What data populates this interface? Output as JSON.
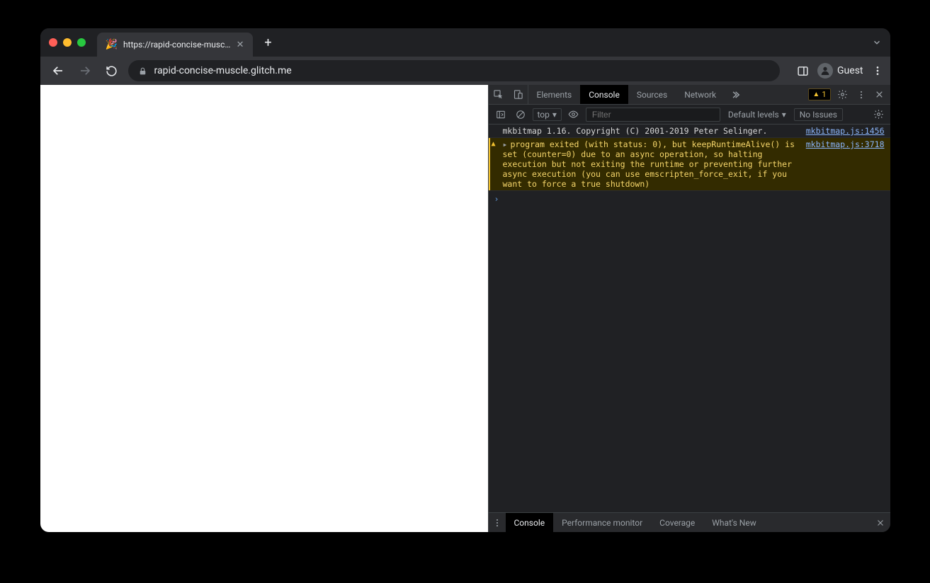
{
  "tab": {
    "favicon": "🎉",
    "title": "https://rapid-concise-muscle.g"
  },
  "omnibox": {
    "url": "rapid-concise-muscle.glitch.me"
  },
  "guest_label": "Guest",
  "devtools": {
    "tabs": {
      "elements": "Elements",
      "console": "Console",
      "sources": "Sources",
      "network": "Network"
    },
    "warning_count": "1",
    "sub": {
      "context": "top",
      "filter_placeholder": "Filter",
      "levels": "Default levels",
      "issues": "No Issues"
    },
    "logs": [
      {
        "type": "log",
        "msg": "mkbitmap 1.16. Copyright (C) 2001-2019 Peter Selinger.",
        "src": "mkbitmap.js:1456"
      },
      {
        "type": "warn",
        "msg": "program exited (with status: 0), but keepRuntimeAlive() is set (counter=0) due to an async operation, so halting execution but not exiting the runtime or preventing further async execution (you can use emscripten_force_exit, if you want to force a true shutdown)",
        "src": "mkbitmap.js:3718"
      }
    ],
    "drawer": {
      "console": "Console",
      "perf": "Performance monitor",
      "coverage": "Coverage",
      "whatsnew": "What's New"
    }
  }
}
